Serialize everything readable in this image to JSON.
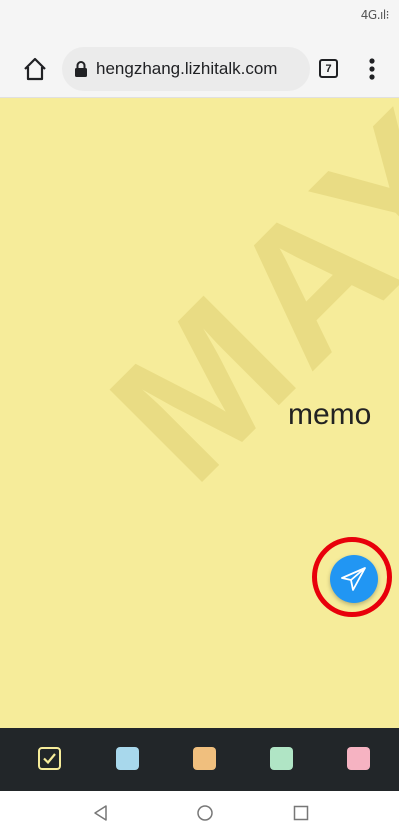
{
  "status_bar": {
    "network": "4G.ıl⁝"
  },
  "browser": {
    "url": "hengzhang.lizhitalk.com",
    "tab_count": "7",
    "icons": {
      "home": "home-icon",
      "lock": "lock-icon",
      "menu": "more-vert-icon"
    }
  },
  "memo": {
    "watermark": "MAY",
    "text": "memo",
    "background_color": "#f6ec9a",
    "send_icon": "paper-plane-icon",
    "send_color": "#2196f3"
  },
  "color_bar": {
    "selected": "yellow",
    "swatches": [
      {
        "name": "yellow",
        "color": "#f6ec9a"
      },
      {
        "name": "blue",
        "color": "#a8d8ec"
      },
      {
        "name": "orange",
        "color": "#f0bf7e"
      },
      {
        "name": "green",
        "color": "#b0e5c5"
      },
      {
        "name": "pink",
        "color": "#f6b3c2"
      }
    ]
  },
  "nav_bar": {
    "icons": [
      "back-triangle-icon",
      "home-circle-icon",
      "recents-square-icon"
    ]
  }
}
